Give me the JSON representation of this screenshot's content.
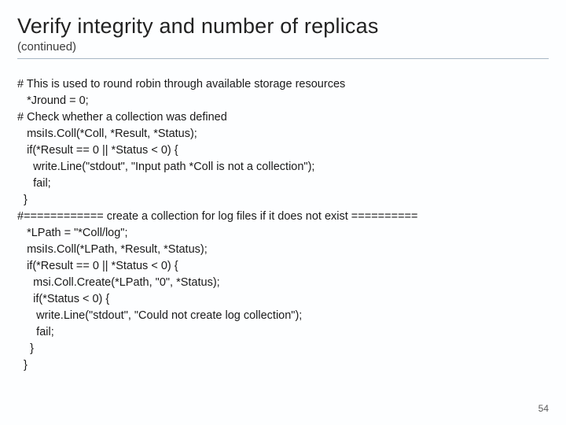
{
  "title": "Verify integrity and number of replicas",
  "subtitle": "(continued)",
  "code": "# This is used to round robin through available storage resources\n   *Jround = 0;\n# Check whether a collection was defined\n   msiIs.Coll(*Coll, *Result, *Status);\n   if(*Result == 0 || *Status < 0) {\n     write.Line(\"stdout\", \"Input path *Coll is not a collection\");\n     fail;\n  }\n#============ create a collection for log files if it does not exist ==========\n   *LPath = \"*Coll/log\";\n   msiIs.Coll(*LPath, *Result, *Status);\n   if(*Result == 0 || *Status < 0) {\n     msi.Coll.Create(*LPath, \"0\", *Status);\n     if(*Status < 0) {\n      write.Line(\"stdout\", \"Could not create log collection\");\n      fail;\n    }\n  }",
  "page_number": "54"
}
